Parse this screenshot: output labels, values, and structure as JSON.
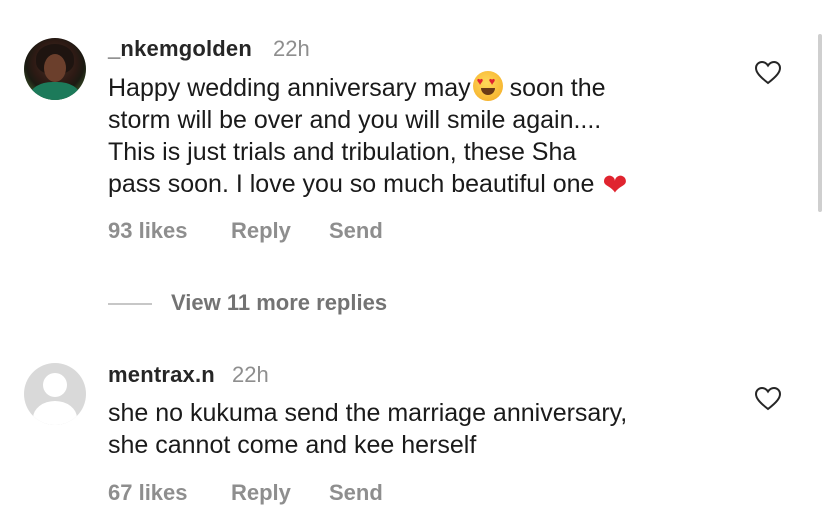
{
  "comments": [
    {
      "username": "_nkemgolden",
      "time": "22h",
      "text_parts": [
        "Happy wedding anniversary may",
        " soon the",
        "storm will be over and you will smile again....",
        "This is just trials and tribulation, these Sha",
        "pass soon. I love you so much beautiful one"
      ],
      "emojis": [
        "heart-eyes-emoji",
        "red-heart-emoji"
      ],
      "likes": "93 likes",
      "reply": "Reply",
      "send": "Send"
    },
    {
      "username": "mentrax.n",
      "time": "22h",
      "text_lines": [
        "she no kukuma send the marriage anniversary,",
        "she cannot come and kee herself"
      ],
      "likes": "67 likes",
      "reply": "Reply",
      "send": "Send"
    }
  ],
  "view_replies": "View 11 more replies",
  "colors": {
    "text": "#1a1a1a",
    "muted": "#8e8e8e",
    "heart": "#e0242f"
  }
}
